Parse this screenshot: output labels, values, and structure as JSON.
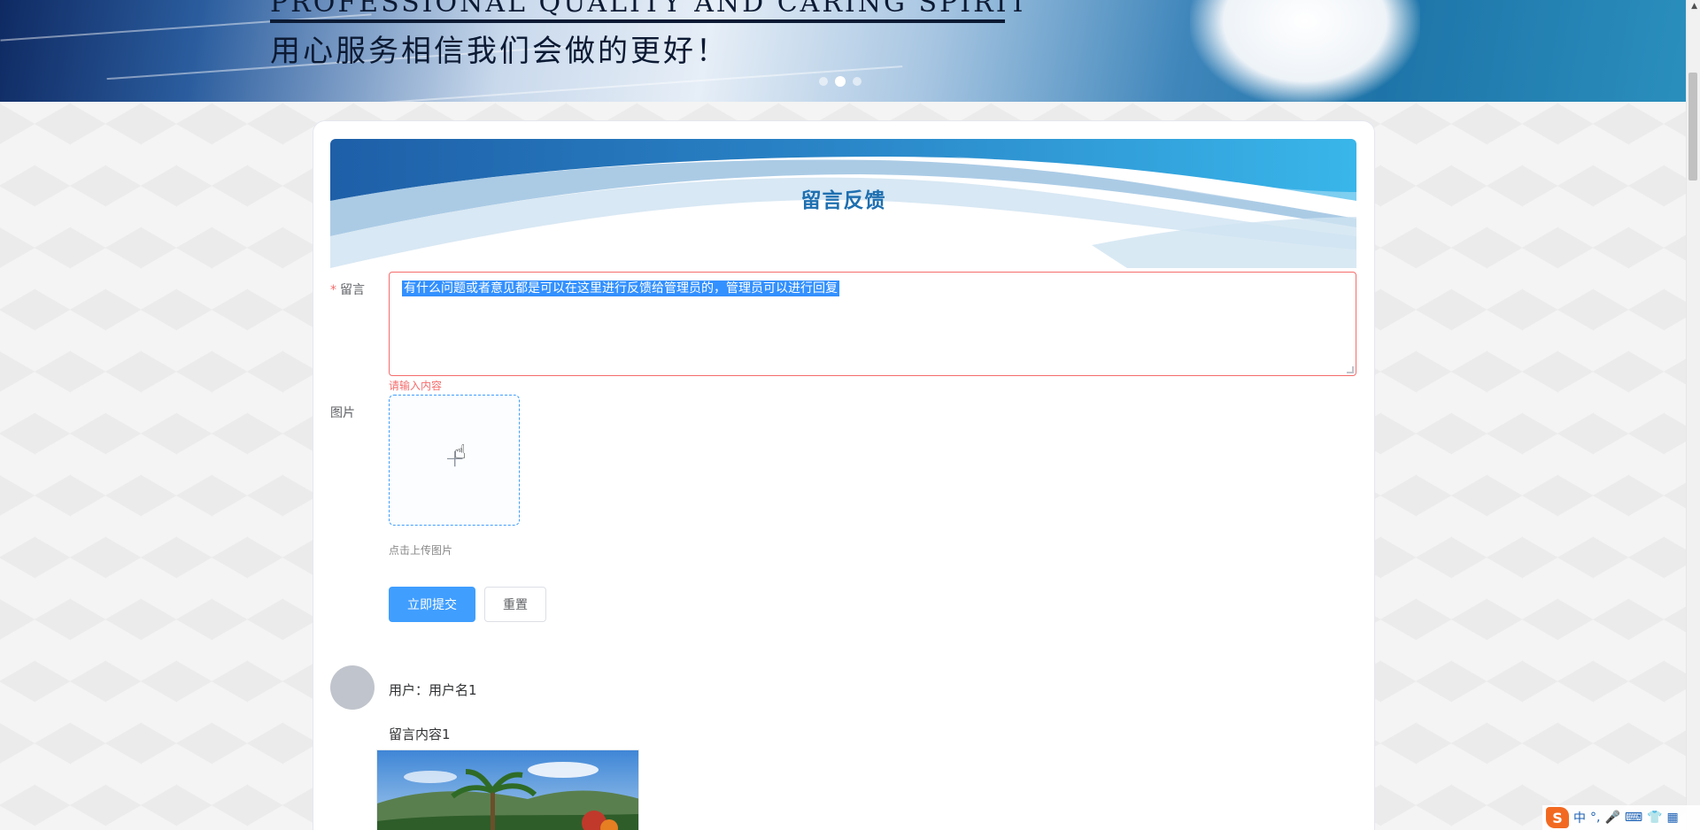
{
  "banner": {
    "english_title": "PROFESSIONAL QUALITY AND CARING SPIRIT",
    "chinese_slogan": "用心服务相信我们会做的更好！",
    "carousel_dots": 3,
    "active_dot": 1
  },
  "feedback": {
    "title": "留言反馈",
    "message_label": "留言",
    "message_value": "有什么问题或者意见都是可以在这里进行反馈给管理员的，管理员可以进行回复",
    "message_error": "请输入内容",
    "image_label": "图片",
    "upload_plus": "+",
    "upload_hint": "点击上传图片",
    "submit_label": "立即提交",
    "reset_label": "重置"
  },
  "messages": [
    {
      "user_label": "用户：用户名1",
      "content": "留言内容1"
    }
  ],
  "ime": {
    "logo": "S",
    "lang": "中",
    "punct": "°,",
    "mic": "🎤",
    "keyboard": "⌨",
    "skin": "👕",
    "menu": "▦"
  },
  "colors": {
    "primary": "#409eff",
    "error": "#f56c6c",
    "title_blue": "#1e6fb0"
  }
}
